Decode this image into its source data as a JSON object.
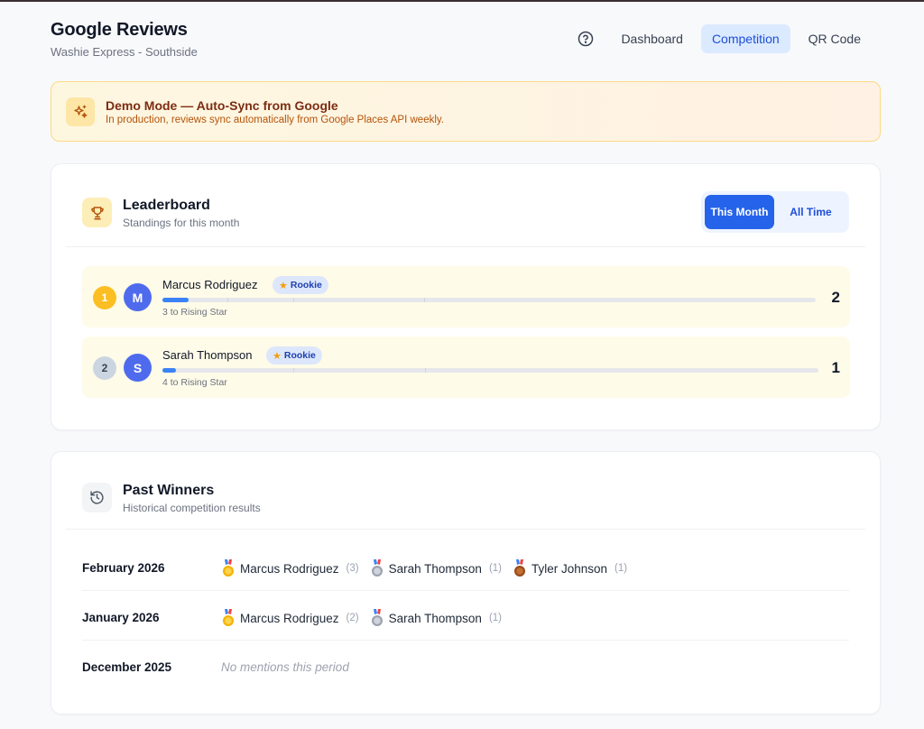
{
  "header": {
    "title": "Google Reviews",
    "subtitle": "Washie Express - Southside"
  },
  "nav": {
    "help_icon": "help-circle-icon",
    "tabs": [
      {
        "label": "Dashboard",
        "active": false
      },
      {
        "label": "Competition",
        "active": true
      },
      {
        "label": "QR Code",
        "active": false
      }
    ]
  },
  "banner": {
    "icon": "sparkles-icon",
    "title": "Demo Mode — Auto-Sync from Google",
    "text": "In production, reviews sync automatically from Google Places API weekly."
  },
  "leaderboard": {
    "icon": "trophy-icon",
    "title": "Leaderboard",
    "subtitle": "Standings for this month",
    "toggle": [
      {
        "label": "This Month",
        "active": true
      },
      {
        "label": "All Time",
        "active": false
      }
    ],
    "rows": [
      {
        "rank": "1",
        "initial": "M",
        "name": "Marcus Rodriguez",
        "badge": "Rookie",
        "progress_fraction": 0.04,
        "next": "3 to Rising Star",
        "score": "2"
      },
      {
        "rank": "2",
        "initial": "S",
        "name": "Sarah Thompson",
        "badge": "Rookie",
        "progress_fraction": 0.02,
        "next": "4 to Rising Star",
        "score": "1"
      }
    ]
  },
  "past_winners": {
    "icon": "history-icon",
    "title": "Past Winners",
    "subtitle": "Historical competition results",
    "periods": [
      {
        "month": "February 2026",
        "winners": [
          {
            "medal": "gold-medal-icon",
            "name": "Marcus Rodriguez",
            "count": "(3)"
          },
          {
            "medal": "silver-medal-icon",
            "name": "Sarah Thompson",
            "count": "(1)"
          },
          {
            "medal": "bronze-medal-icon",
            "name": "Tyler Johnson",
            "count": "(1)"
          }
        ]
      },
      {
        "month": "January 2026",
        "winners": [
          {
            "medal": "gold-medal-icon",
            "name": "Marcus Rodriguez",
            "count": "(2)"
          },
          {
            "medal": "silver-medal-icon",
            "name": "Sarah Thompson",
            "count": "(1)"
          }
        ]
      },
      {
        "month": "December 2025",
        "empty": "No mentions this period",
        "winners": []
      }
    ]
  },
  "colors": {
    "accent": "#2563eb",
    "gold": "#fbbf24",
    "silver": "#cbd5e1",
    "avatar": "#4f6bed",
    "row_bg": "#fefbe8"
  }
}
